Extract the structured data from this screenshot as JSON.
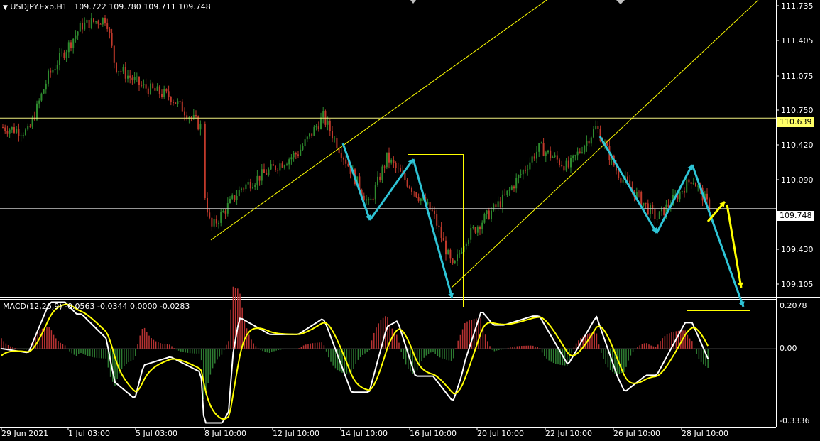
{
  "header": {
    "symbol": "USDJPY.Exp,H1",
    "ohlc": "109.722 109.780 109.711 109.748"
  },
  "macd": {
    "label": "MACD(12,26,9)",
    "values": "-0.0563 -0.0344 0.0000 -0.0283",
    "scale_ticks": [
      "0.2078",
      "0.00",
      "-0.3336"
    ]
  },
  "price_axis": {
    "ticks": [
      "111.735",
      "111.405",
      "111.075",
      "110.750",
      "110.420",
      "110.090",
      "109.430",
      "109.105"
    ],
    "hline_label": "110.639",
    "current_label": "109.748"
  },
  "time_axis": {
    "labels": [
      "29 Jun 2021",
      "1 Jul 03:00",
      "5 Jul 03:00",
      "8 Jul 10:00",
      "12 Jul 10:00",
      "14 Jul 10:00",
      "16 Jul 10:00",
      "20 Jul 10:00",
      "22 Jul 10:00",
      "26 Jul 10:00",
      "28 Jul 10:00"
    ]
  },
  "colors": {
    "background": "#000000",
    "bull": "#2e8b2e",
    "bear": "#c0392b",
    "trend": "#ffff00",
    "arrows": "#2ec4d6",
    "macd_line": "#ffffff",
    "signal_line": "#ffff00",
    "hist_pos": "#b83232",
    "hist_neg": "#2e7d32",
    "hline": "#f0f080",
    "current_tag_bg": "#ffffff",
    "hline_tag_bg": "#ffff66"
  },
  "chart_data": {
    "type": "candlestick",
    "symbol": "USDJPY.Exp",
    "timeframe": "H1",
    "y_range": [
      108.88,
      111.8
    ],
    "horizontal_level": 110.639,
    "current_price": 109.748,
    "price_path": [
      {
        "x": "29 Jun 2021",
        "y": 110.55
      },
      {
        "x": "30 Jun",
        "y": 110.5
      },
      {
        "x": "30 Jun 12:00",
        "y": 111.05
      },
      {
        "x": "1 Jul 03:00",
        "y": 111.55
      },
      {
        "x": "2 Jul",
        "y": 111.62
      },
      {
        "x": "2 Jul 12:00",
        "y": 111.15
      },
      {
        "x": "5 Jul 03:00",
        "y": 110.95
      },
      {
        "x": "6 Jul",
        "y": 110.85
      },
      {
        "x": "7 Jul",
        "y": 110.55
      },
      {
        "x": "8 Jul 10:00",
        "y": 109.95
      },
      {
        "x": "8 Jul 12:00",
        "y": 109.55
      },
      {
        "x": "9 Jul",
        "y": 109.95
      },
      {
        "x": "12 Jul 10:00",
        "y": 110.3
      },
      {
        "x": "13 Jul",
        "y": 110.65
      },
      {
        "x": "14 Jul 10:00",
        "y": 109.78
      },
      {
        "x": "15 Jul",
        "y": 110.25
      },
      {
        "x": "16 Jul 10:00",
        "y": 109.7
      },
      {
        "x": "16 Jul 20:00",
        "y": 109.15
      },
      {
        "x": "19 Jul",
        "y": 109.45
      },
      {
        "x": "20 Jul 10:00",
        "y": 109.85
      },
      {
        "x": "21 Jul",
        "y": 110.35
      },
      {
        "x": "22 Jul 10:00",
        "y": 110.15
      },
      {
        "x": "23 Jul",
        "y": 110.55
      },
      {
        "x": "26 Jul 10:00",
        "y": 110.1
      },
      {
        "x": "27 Jul",
        "y": 109.65
      },
      {
        "x": "28 Jul 10:00",
        "y": 110.05
      },
      {
        "x": "29 Jul",
        "y": 109.75
      }
    ],
    "macd": {
      "fast": 12,
      "slow": 26,
      "signal": 9,
      "main": -0.0563,
      "signal_value": -0.0344,
      "third": 0.0,
      "fourth": -0.0283,
      "y_range": [
        -0.3336,
        0.2078
      ]
    }
  }
}
